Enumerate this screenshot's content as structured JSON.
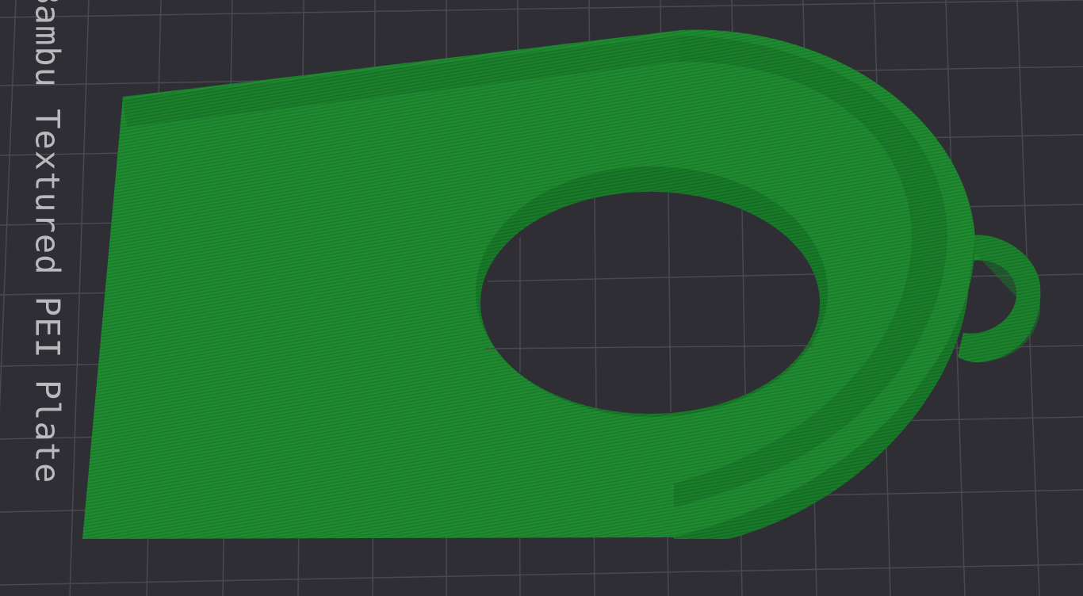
{
  "viewport": {
    "bed_label": "Bambu Textured PEI Plate",
    "model_color": "#1f8a30",
    "background_color": "#2f2e34",
    "grid_color": "#4a4950"
  }
}
